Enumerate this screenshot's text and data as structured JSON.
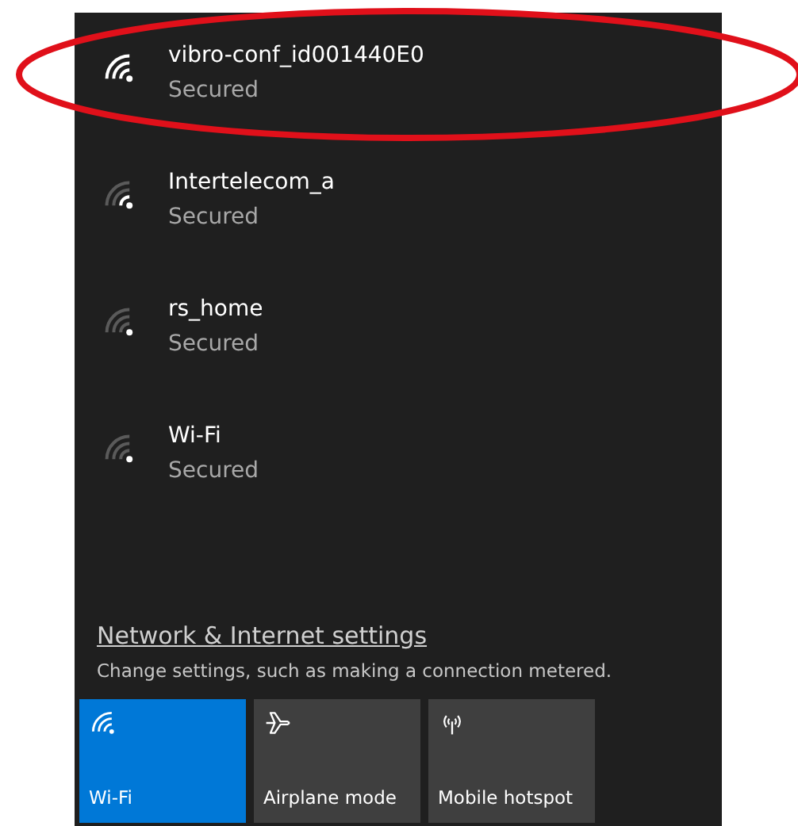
{
  "networks": [
    {
      "name": "vibro-conf_id001440E0",
      "status": "Secured",
      "kind": "strong",
      "highlighted": true
    },
    {
      "name": "Intertelecom_a",
      "status": "Secured",
      "kind": "medium",
      "highlighted": false
    },
    {
      "name": "rs_home",
      "status": "Secured",
      "kind": "weak",
      "highlighted": false
    },
    {
      "name": "Wi-Fi",
      "status": "Secured",
      "kind": "weak",
      "highlighted": false
    }
  ],
  "settings_link": "Network & Internet settings",
  "settings_description": "Change settings, such as making a connection metered.",
  "quick_actions": [
    {
      "kind": "wifi",
      "label": "Wi-Fi",
      "on": true
    },
    {
      "kind": "airplane",
      "label": "Airplane mode",
      "on": false
    },
    {
      "kind": "hotspot",
      "label": "Mobile hotspot",
      "on": false
    }
  ]
}
